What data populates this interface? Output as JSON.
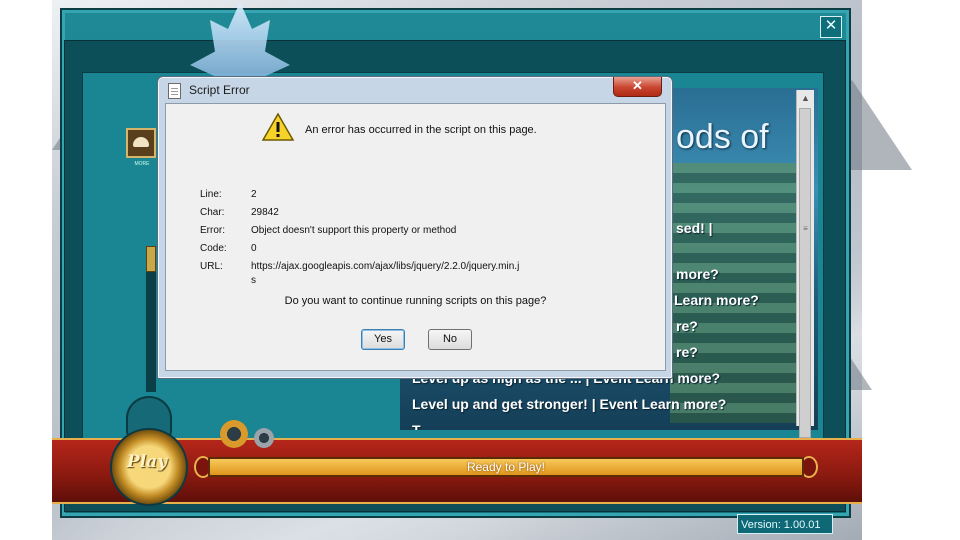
{
  "launcher": {
    "close_glyph": "✕",
    "side_icon_label": "MORE",
    "news": {
      "title_fragment": "ods of",
      "lines": [
        "sed! |",
        "more?",
        "Learn more?",
        "re?",
        "re?",
        "Level up as high as the ... | Event Learn more?",
        "Level up and get stronger! | Event Learn more?",
        "T..."
      ],
      "scroll_grip": "≡"
    },
    "play_button": {
      "label": "Play"
    },
    "progress": {
      "label": "Ready to Play!",
      "value": 1.0
    },
    "version": "Version: 1.00.01"
  },
  "dialog": {
    "title": "Script Error",
    "close_glyph": "✕",
    "icon": "warning-icon",
    "message": "An error has occurred in the script on this page.",
    "details": [
      {
        "label": "Line:",
        "value": "2"
      },
      {
        "label": "Char:",
        "value": "29842"
      },
      {
        "label": "Error:",
        "value": "Object doesn't support this property or method"
      },
      {
        "label": "Code:",
        "value": "0"
      },
      {
        "label": "URL:",
        "value": "https://ajax.googleapis.com/ajax/libs/jquery/2.2.0/jquery.min.j"
      }
    ],
    "url_wrap": "s",
    "question": "Do you want to continue running scripts on this page?",
    "buttons": {
      "yes": "Yes",
      "no": "No"
    }
  },
  "colors": {
    "frame_teal": "#1f8a96",
    "banner_red": "#b5261a",
    "progress_gold": "#f4c24d",
    "dialog_chrome": "#c7d6e6"
  }
}
